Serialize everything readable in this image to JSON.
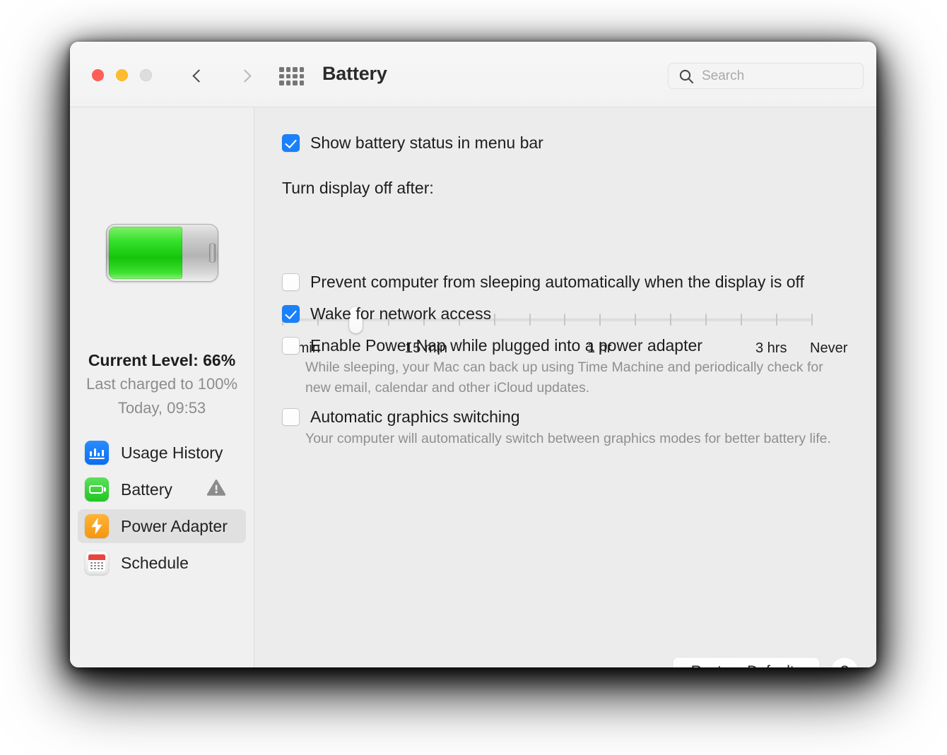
{
  "window": {
    "title": "Battery",
    "traffic_lights": [
      "close",
      "minimize",
      "zoom"
    ],
    "nav": {
      "back": "back-chevron",
      "forward": "forward-chevron"
    },
    "grid_button": "show-all-preferences",
    "search": {
      "placeholder": "Search",
      "value": "",
      "icon": "search-icon"
    }
  },
  "sidebar": {
    "battery_icon": "battery-graphic",
    "battery_level_percent": 66,
    "current_level": "Current Level: 66%",
    "last_charged": "Last charged to 100%",
    "last_charged_time": "Today, 09:53",
    "items": [
      {
        "label": "Usage History",
        "icon": "usage-history-icon",
        "selected": false,
        "warning": false
      },
      {
        "label": "Battery",
        "icon": "battery-icon",
        "selected": false,
        "warning": true
      },
      {
        "label": "Power Adapter",
        "icon": "power-adapter-icon",
        "selected": true,
        "warning": false
      },
      {
        "label": "Schedule",
        "icon": "schedule-icon",
        "selected": false,
        "warning": false
      }
    ]
  },
  "main": {
    "menu_bar_checkbox": {
      "label": "Show battery status in menu bar",
      "checked": true
    },
    "display_off": {
      "label": "Turn display off after:",
      "tick_count": 16,
      "thumb_index": 2,
      "tick_labels": [
        "1 min",
        "15 min",
        "1 hr",
        "3 hrs",
        "Never"
      ]
    },
    "options": [
      {
        "label": "Prevent computer from sleeping automatically when the display is off",
        "checked": false,
        "description": ""
      },
      {
        "label": "Wake for network access",
        "checked": true,
        "description": ""
      },
      {
        "label": "Enable Power Nap while plugged into a power adapter",
        "checked": false,
        "description": "While sleeping, your Mac can back up using Time Machine and periodically check for new email, calendar and other iCloud updates."
      },
      {
        "label": "Automatic graphics switching",
        "checked": false,
        "description": "Your computer will automatically switch between graphics modes for better battery life."
      }
    ],
    "restore_defaults_label": "Restore Defaults",
    "help_label": "?"
  },
  "colors": {
    "accent": "#1a81fb",
    "battery_green": "#14c40a",
    "power_orange": "#f5960d",
    "usage_blue": "#0a6ff0",
    "calendar_red": "#e8453c"
  }
}
